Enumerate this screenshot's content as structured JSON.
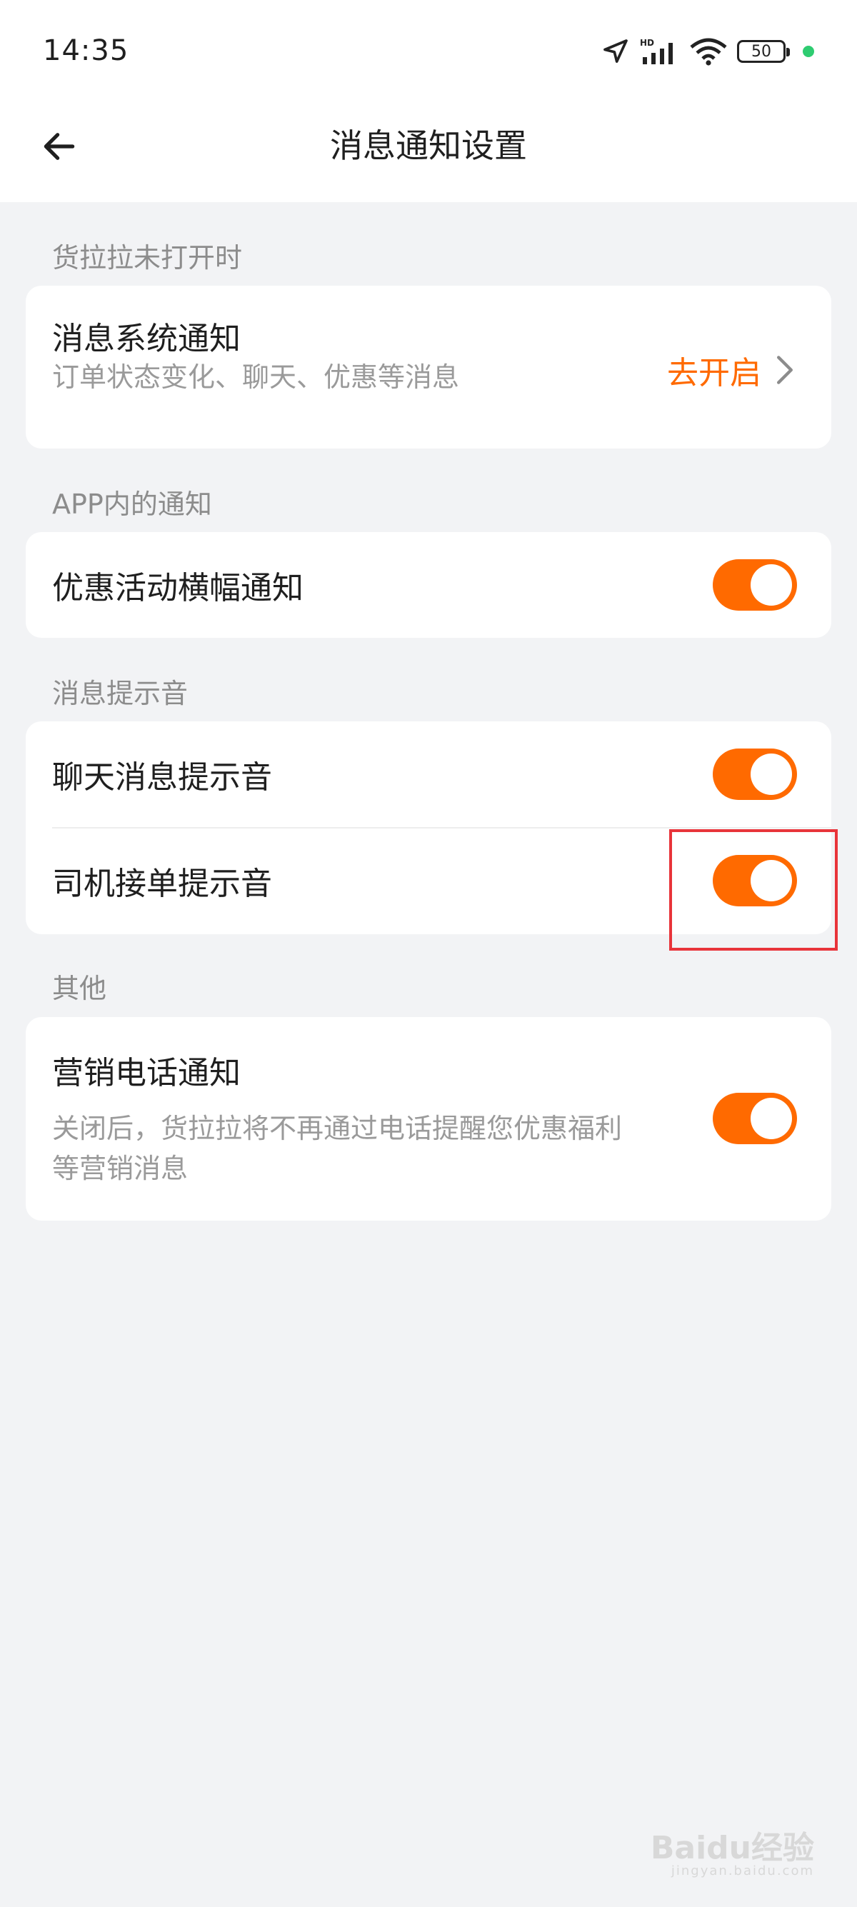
{
  "status_bar": {
    "time": "14:35",
    "battery": "50",
    "icons": [
      "location-arrow-icon",
      "hd-signal-icon",
      "wifi-icon",
      "battery-icon",
      "status-dot-icon"
    ]
  },
  "header": {
    "title": "消息通知设置",
    "back_icon": "arrow-left-icon"
  },
  "sections": {
    "closed": {
      "label": "货拉拉未打开时",
      "item": {
        "title": "消息系统通知",
        "subtitle": "订单状态变化、聊天、优惠等消息",
        "action": "去开启",
        "action_icon": "chevron-right-icon"
      }
    },
    "in_app": {
      "label": "APP内的通知",
      "item": {
        "title": "优惠活动横幅通知",
        "toggle_on": true
      }
    },
    "sound": {
      "label": "消息提示音",
      "items": [
        {
          "title": "聊天消息提示音",
          "toggle_on": true
        },
        {
          "title": "司机接单提示音",
          "toggle_on": true
        }
      ]
    },
    "other": {
      "label": "其他",
      "item": {
        "title": "营销电话通知",
        "subtitle_line1": "关闭后，货拉拉将不再通过电话提醒您优惠福利",
        "subtitle_line2": "等营销消息",
        "toggle_on": true
      }
    }
  },
  "colors": {
    "accent": "#ff6a00",
    "background": "#f2f3f5",
    "highlight": "#e8343a"
  },
  "watermark": {
    "text": "Baidu经验",
    "sub": "jingyan.baidu.com"
  }
}
